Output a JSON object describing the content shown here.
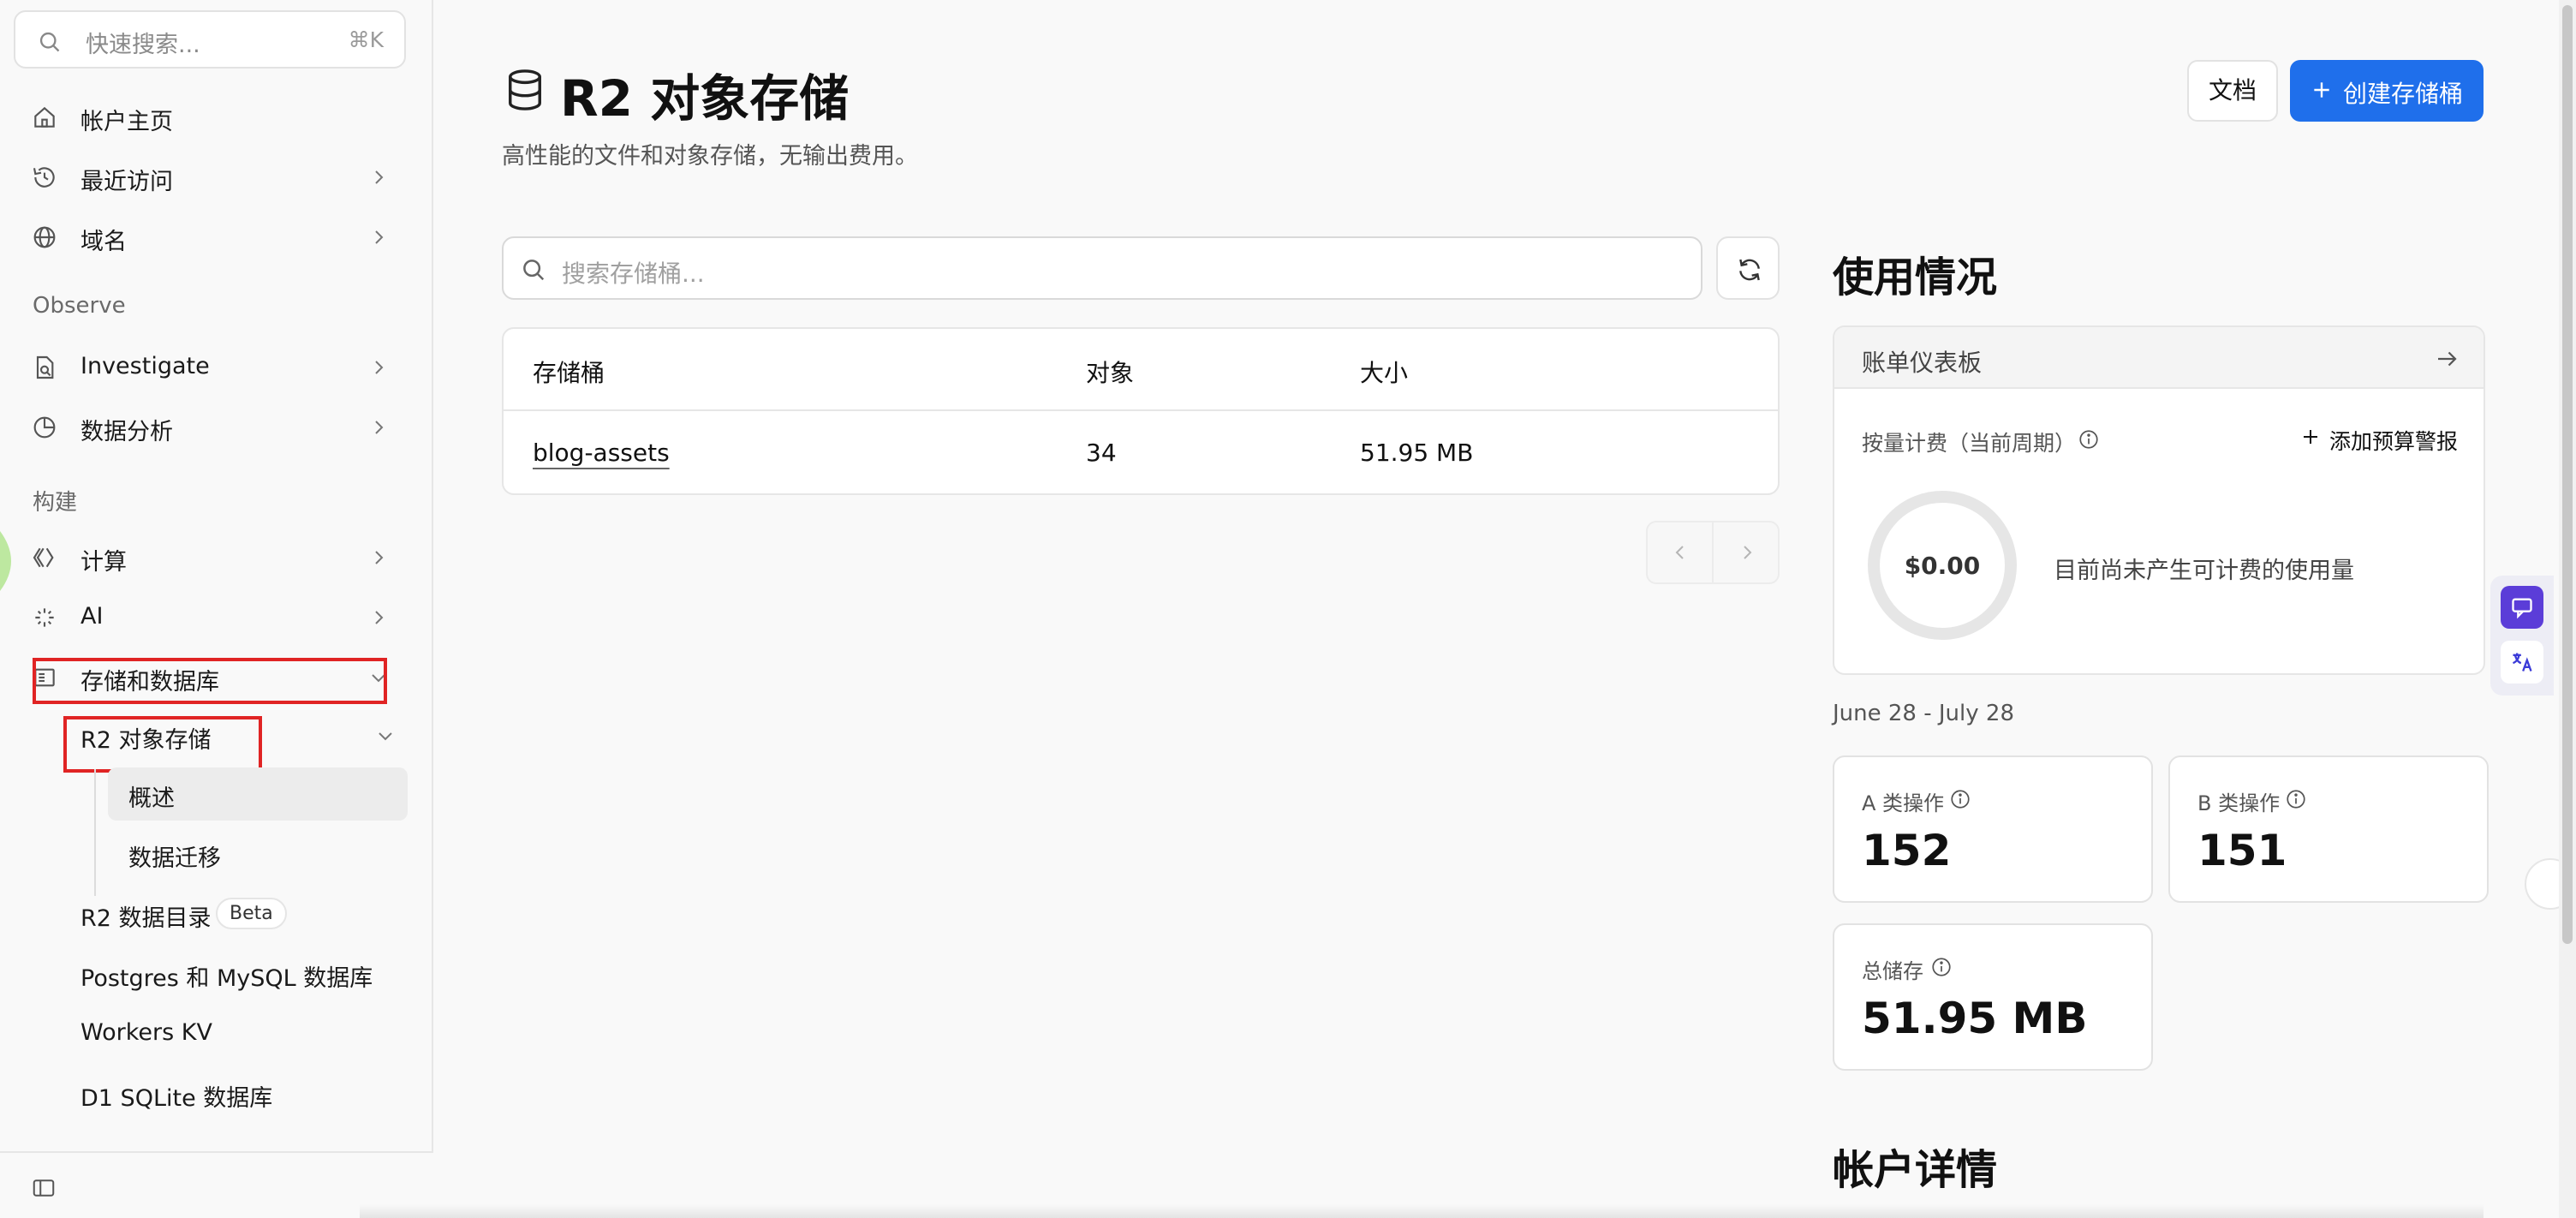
{
  "sidebar": {
    "search": {
      "placeholder": "快速搜索...",
      "shortcut": "⌘K"
    },
    "items": [
      {
        "label": "帐户主页",
        "icon": "home-icon"
      },
      {
        "label": "最近访问",
        "icon": "history-icon"
      },
      {
        "label": "域名",
        "icon": "globe-icon"
      }
    ],
    "sections": {
      "observe": "Observe",
      "build": "构建"
    },
    "observe_items": [
      {
        "label": "Investigate",
        "icon": "file-search-icon"
      },
      {
        "label": "数据分析",
        "icon": "pie-chart-icon"
      }
    ],
    "build_items": [
      {
        "label": "计算",
        "icon": "compute-icon"
      },
      {
        "label": "AI",
        "icon": "sparkle-icon"
      },
      {
        "label": "存储和数据库",
        "icon": "storage-icon"
      }
    ],
    "storage": {
      "r2_label": "R2 对象存储",
      "r2_children": [
        "概述",
        "数据迁移"
      ],
      "catalog_label": "R2 数据目录",
      "catalog_badge": "Beta",
      "postgres_label": "Postgres 和 MySQL 数据库",
      "kv_label": "Workers KV",
      "d1_label": "D1 SQLite 数据库"
    }
  },
  "header": {
    "title": "R2 对象存储",
    "subtitle": "高性能的文件和对象存储，无输出费用。",
    "docs_label": "文档",
    "create_label": "创建存储桶"
  },
  "buckets": {
    "search_placeholder": "搜索存储桶...",
    "columns": [
      "存储桶",
      "对象",
      "大小"
    ],
    "rows": [
      {
        "name": "blog-assets",
        "objects": "34",
        "size": "51.95 MB"
      }
    ]
  },
  "usage": {
    "title": "使用情况",
    "billing_dashboard": "账单仪表板",
    "metered_label": "按量计费（当前周期）",
    "add_alert": "添加预算警报",
    "amount": "$0.00",
    "no_usage": "目前尚未产生可计费的使用量",
    "date_range": "June 28 - July 28",
    "class_a_label": "A 类操作",
    "class_a_value": "152",
    "class_b_label": "B 类操作",
    "class_b_value": "151",
    "storage_label": "总储存",
    "storage_value": "51.95 MB"
  },
  "account": {
    "title": "帐户详情"
  },
  "colors": {
    "accent": "#1f6feb",
    "highlight": "#e02424",
    "widget": "#5b3dd8"
  }
}
